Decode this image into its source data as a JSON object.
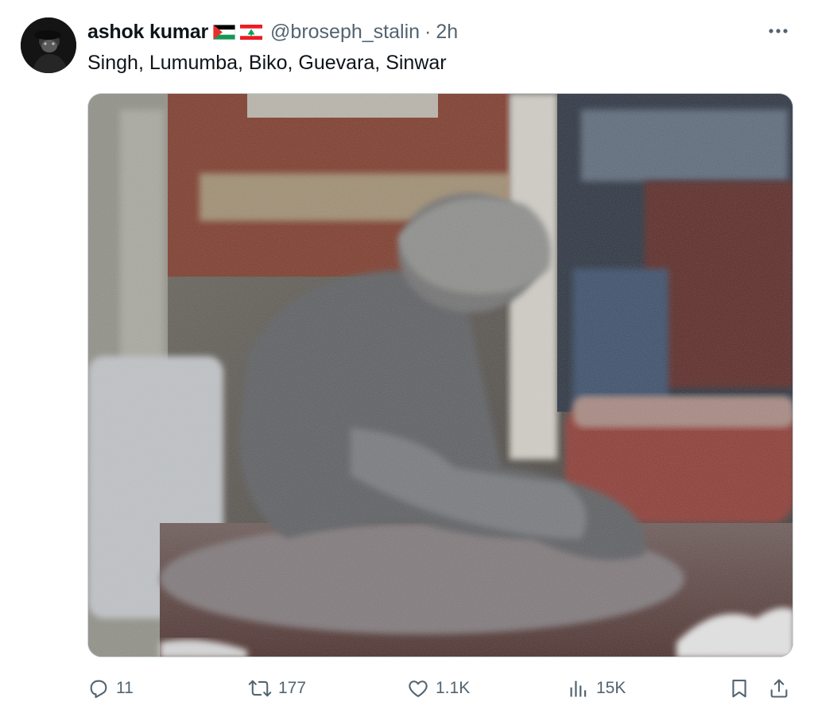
{
  "tweet": {
    "author_name": "ashok kumar",
    "handle": "@broseph_stalin",
    "separator": "·",
    "time": "2h",
    "text": "Singh, Lumumba, Biko, Guevara, Sinwar",
    "flags": [
      "palestine-flag",
      "lebanon-flag"
    ]
  },
  "actions": {
    "replies": "11",
    "reposts": "177",
    "likes": "1.1K",
    "views": "15K"
  },
  "icons": {
    "more": "more-dots-icon",
    "reply": "reply-icon",
    "repost": "repost-icon",
    "like": "heart-icon",
    "views": "views-chart-icon",
    "bookmark": "bookmark-icon",
    "share": "share-icon"
  },
  "colors": {
    "text_primary": "#0f1419",
    "text_secondary": "#536471",
    "border": "#cfd9de"
  }
}
